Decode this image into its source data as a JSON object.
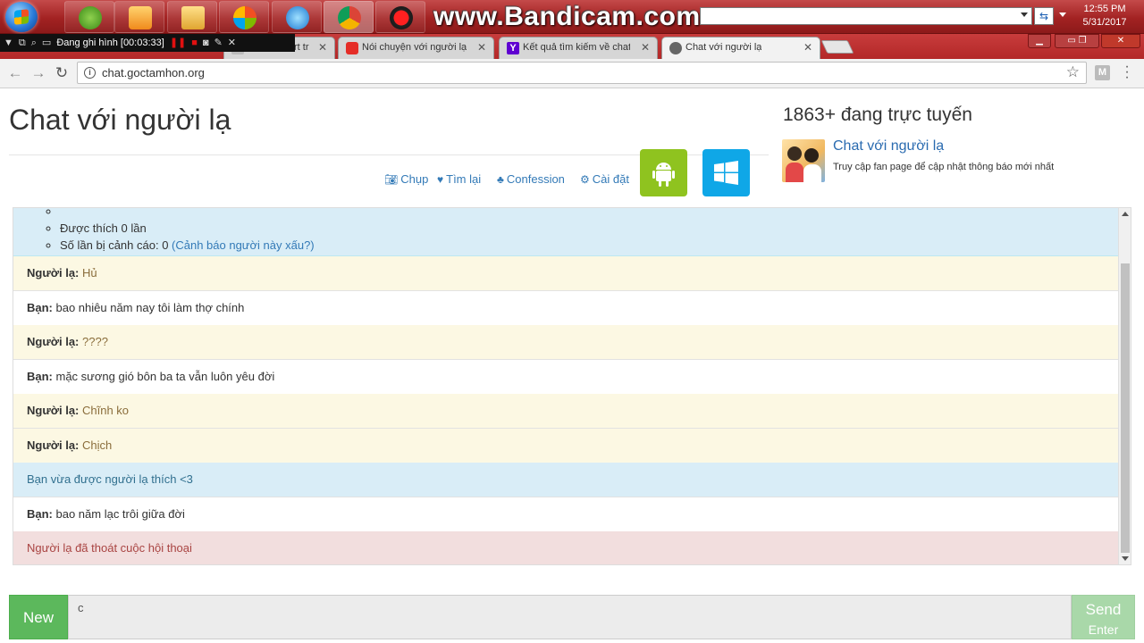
{
  "taskbar": {
    "watermark": "www.Bandicam.com",
    "clock_time": "12:55 PM",
    "clock_date": "5/31/2017",
    "input_lang_icon": "keyboard-lang-icon"
  },
  "recorder": {
    "status": "Đang ghi hình [00:03:33]"
  },
  "tabs": [
    {
      "title": "rt tr",
      "icon": "tab-favicon"
    },
    {
      "title": "Nói chuyện với người lạ",
      "icon": "youtube-icon"
    },
    {
      "title": "Kết quả tìm kiếm về chat",
      "icon": "yahoo-icon"
    },
    {
      "title": "Chat với người lạ",
      "icon": "chat-bubble-icon"
    }
  ],
  "toolbar": {
    "url": "chat.goctamhon.org",
    "extension_label": "M"
  },
  "page": {
    "title": "Chat với người lạ",
    "online_count": "1863+ đang trực tuyến",
    "fanpage_name": "Chat với người lạ",
    "fanpage_desc": "Truy cập fan page để cập nhật thông báo mới nhất",
    "actions": {
      "capture": "Chụp",
      "find_again": "Tìm lại",
      "confession": "Confession",
      "settings": "Cài đặt"
    }
  },
  "info_panel": {
    "liked": "Được thích 0 lần",
    "warned_prefix": "Số lần bị cảnh cáo: 0 ",
    "warn_link": "(Cảnh báo người này xấu?)"
  },
  "messages": [
    {
      "type": "stranger",
      "sender": "Người lạ:",
      "text": " Hủ"
    },
    {
      "type": "me",
      "sender": "Bạn:",
      "text": " bao nhiêu năm nay tôi làm thợ chính"
    },
    {
      "type": "stranger",
      "sender": "Người lạ:",
      "text": " ????"
    },
    {
      "type": "me",
      "sender": "Bạn:",
      "text": " mặc sương gió bôn ba ta vẫn luôn yêu đời"
    },
    {
      "type": "stranger",
      "sender": "Người lạ:",
      "text": " Chĩnh ko"
    },
    {
      "type": "stranger",
      "sender": "Người lạ:",
      "text": " Chịch"
    },
    {
      "type": "notice",
      "sender": "",
      "text": "Bạn vừa được người lạ thích <3"
    },
    {
      "type": "me",
      "sender": "Bạn:",
      "text": " bao năm lạc trôi giữa đời"
    },
    {
      "type": "ended",
      "sender": "",
      "text": "Người lạ đã thoát cuộc hội thoại"
    }
  ],
  "composer": {
    "new_label": "New",
    "input_value": "c",
    "send_label": "Send",
    "send_hint": "Enter"
  }
}
